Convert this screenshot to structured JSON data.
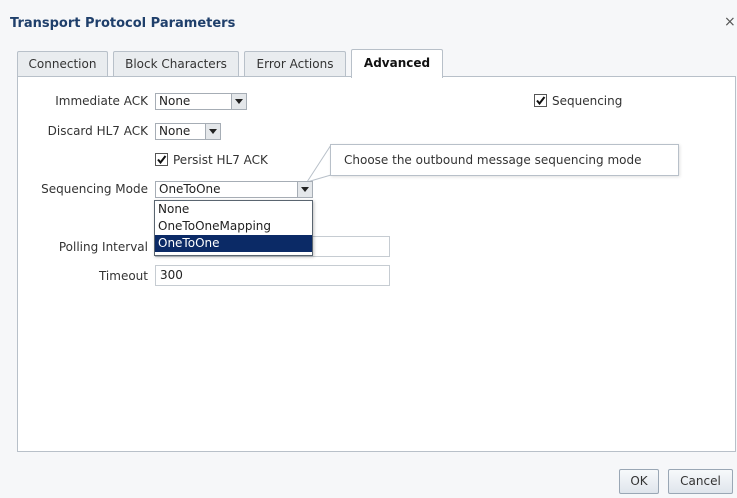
{
  "dialog": {
    "title": "Transport Protocol Parameters",
    "close_glyph": "×"
  },
  "tabs": [
    {
      "label": "Connection"
    },
    {
      "label": "Block Characters"
    },
    {
      "label": "Error Actions"
    },
    {
      "label": "Advanced",
      "active": true
    }
  ],
  "form": {
    "immediate_ack": {
      "label": "Immediate ACK",
      "value": "None"
    },
    "discard_hl7_ack": {
      "label": "Discard HL7 ACK",
      "value": "None"
    },
    "persist_hl7_ack": {
      "label": "Persist HL7 ACK",
      "checked": true
    },
    "sequencing": {
      "label": "Sequencing",
      "checked": true
    },
    "sequencing_mode": {
      "label": "Sequencing Mode",
      "value": "OneToOne",
      "options": [
        "None",
        "OneToOneMapping",
        "OneToOne"
      ],
      "highlighted": "OneToOne"
    },
    "polling_interval": {
      "label": "Polling Interval",
      "value": ""
    },
    "timeout": {
      "label": "Timeout",
      "value": "300"
    }
  },
  "tooltip": {
    "text": "Choose the outbound message sequencing mode"
  },
  "buttons": {
    "ok": "OK",
    "cancel": "Cancel"
  },
  "colors": {
    "title": "#1f3f6b",
    "selection": "#0b2a66",
    "background": "#f6f7f9"
  }
}
